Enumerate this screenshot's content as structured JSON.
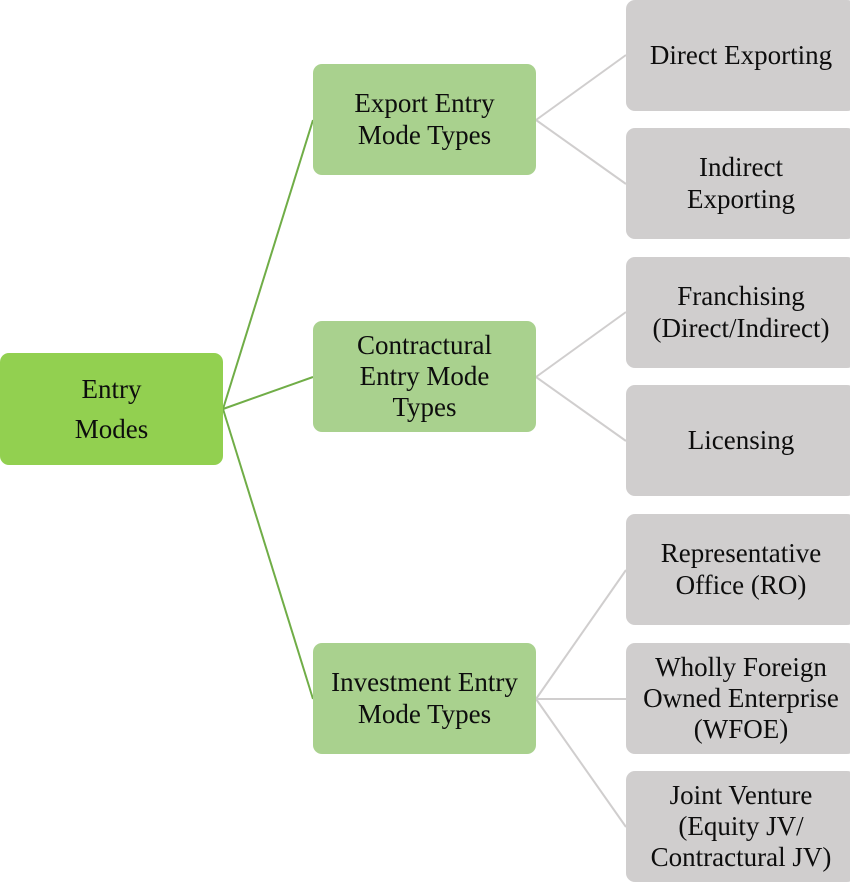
{
  "diagram": {
    "type": "tree",
    "colors": {
      "root_fill": "#92d050",
      "level1_fill": "#a9d18e",
      "level2_fill": "#d0cece",
      "root_connector": "#70ad47",
      "level1_connector": "#d0cece"
    },
    "root": {
      "label": "Entry\nModes"
    },
    "categories": [
      {
        "label": "Export Entry\nMode Types",
        "children": [
          {
            "label": "Direct Exporting"
          },
          {
            "label": "Indirect\nExporting"
          }
        ]
      },
      {
        "label": "Contractural\nEntry Mode\nTypes",
        "children": [
          {
            "label": "Franchising\n(Direct/Indirect)"
          },
          {
            "label": "Licensing"
          }
        ]
      },
      {
        "label": "Investment Entry\nMode Types",
        "children": [
          {
            "label": "Representative\nOffice (RO)"
          },
          {
            "label": "Wholly Foreign\nOwned Enterprise\n(WFOE)"
          },
          {
            "label": "Joint Venture\n(Equity JV/\nContractural JV)"
          }
        ]
      }
    ]
  }
}
